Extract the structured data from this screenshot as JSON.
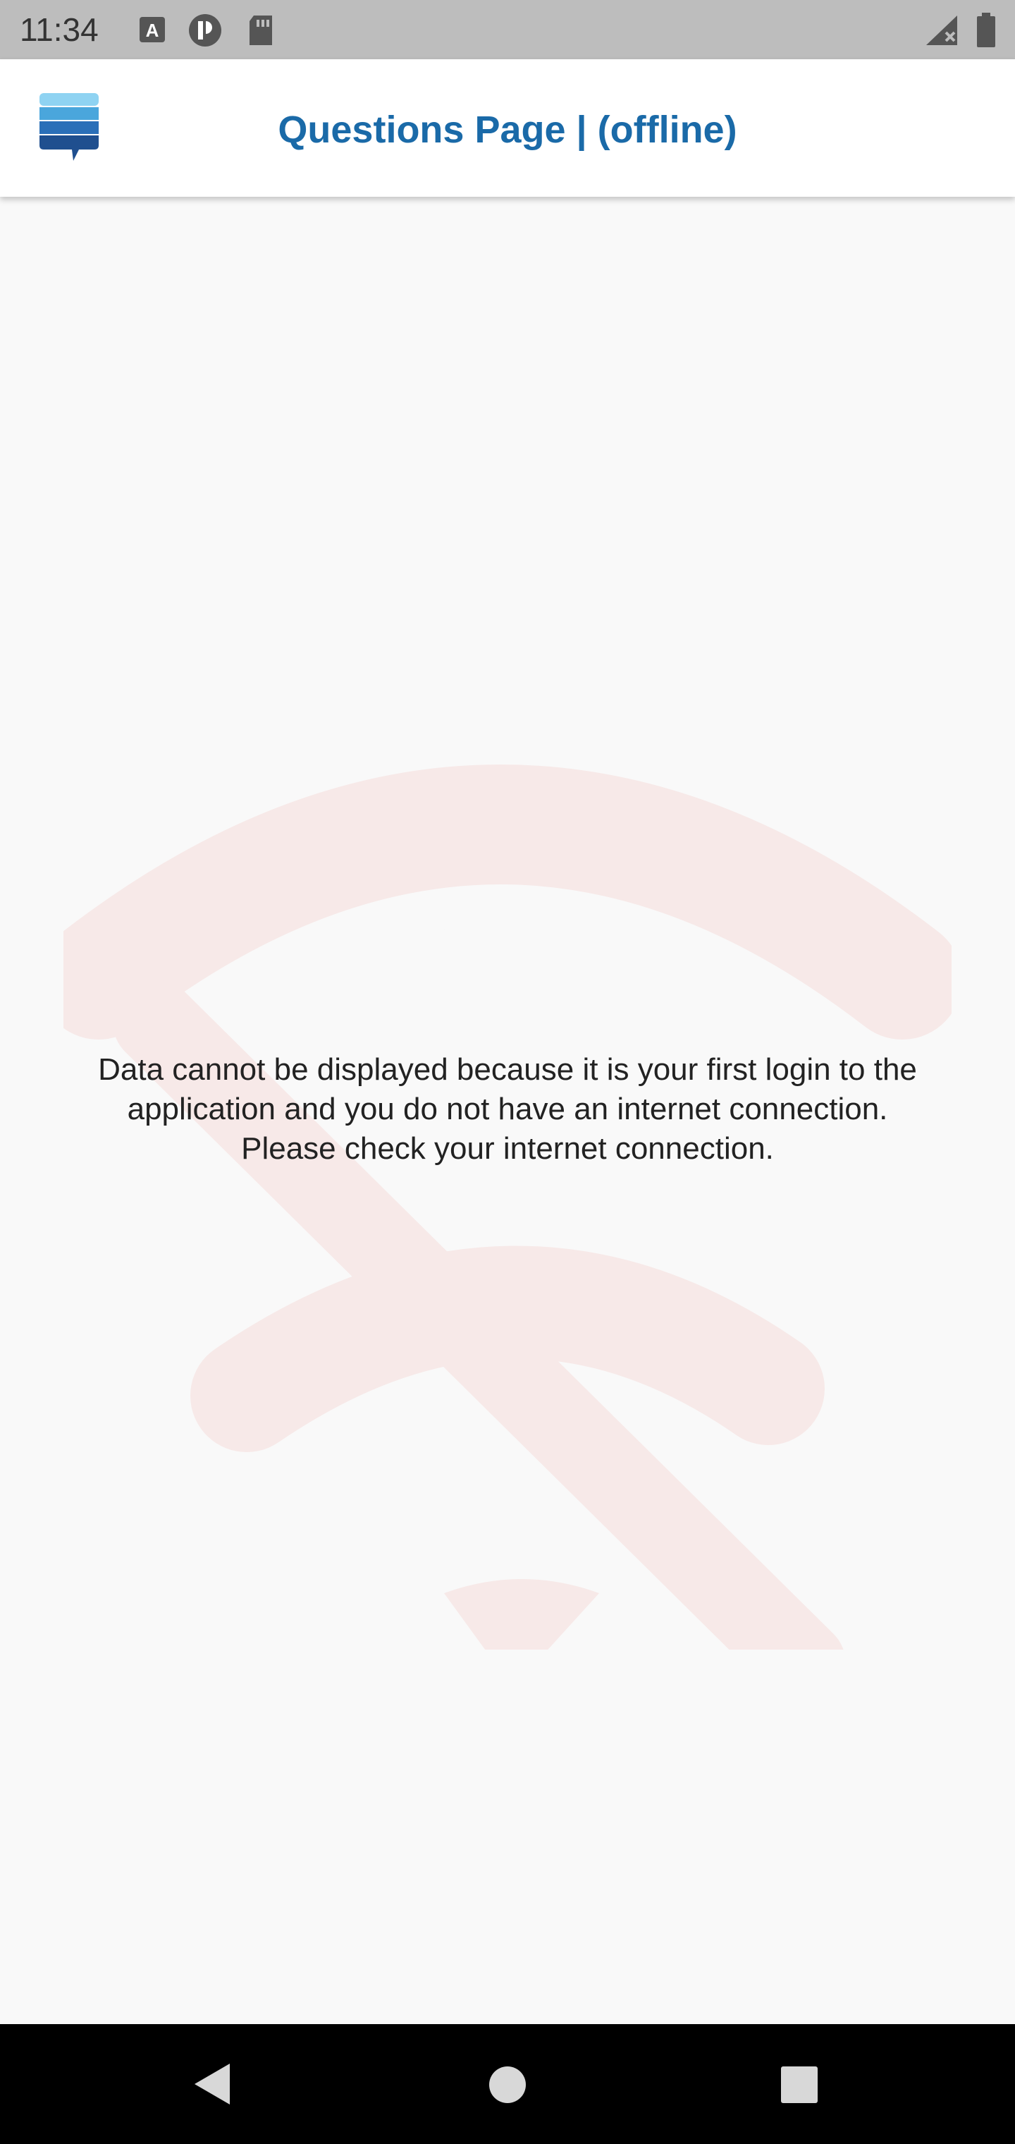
{
  "status_bar": {
    "time": "11:34",
    "icons_left": [
      "keyboard-a-icon",
      "app-circle-icon",
      "sd-card-icon"
    ],
    "icons_right": [
      "signal-off-icon",
      "battery-icon"
    ]
  },
  "app_bar": {
    "logo_icon": "stack-chat-logo-icon",
    "title": "Questions Page | (offline)"
  },
  "main": {
    "background_icon": "wifi-off-icon",
    "message_lines": [
      "Data cannot be displayed because it is your first login to the",
      "application and you do not have an internet connection.",
      "Please check your internet connection."
    ]
  },
  "nav_bar": {
    "buttons": [
      "back-icon",
      "home-icon",
      "recents-icon"
    ]
  },
  "colors": {
    "title": "#1a6aa8",
    "status_bar": "#bdbdbd",
    "wifi_watermark": "#f7e9e8"
  }
}
